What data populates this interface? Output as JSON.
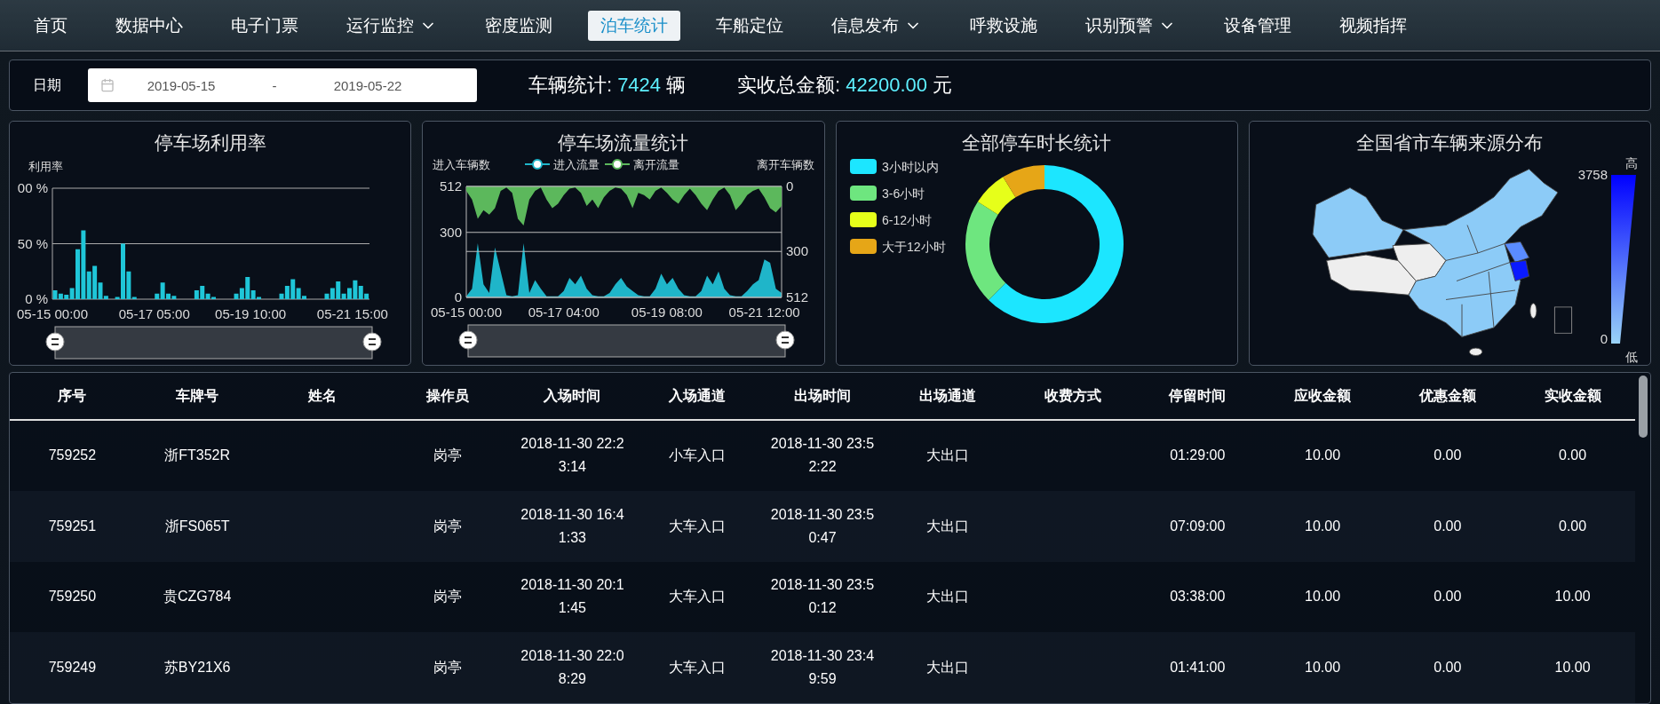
{
  "nav": {
    "items": [
      {
        "label": "首页",
        "selected": false,
        "has_menu": false
      },
      {
        "label": "数据中心",
        "selected": false,
        "has_menu": false
      },
      {
        "label": "电子门票",
        "selected": false,
        "has_menu": false
      },
      {
        "label": "运行监控",
        "selected": false,
        "has_menu": true
      },
      {
        "label": "密度监测",
        "selected": false,
        "has_menu": false
      },
      {
        "label": "泊车统计",
        "selected": true,
        "has_menu": false
      },
      {
        "label": "车船定位",
        "selected": false,
        "has_menu": false
      },
      {
        "label": "信息发布",
        "selected": false,
        "has_menu": true
      },
      {
        "label": "呼救设施",
        "selected": false,
        "has_menu": false
      },
      {
        "label": "识别预警",
        "selected": false,
        "has_menu": true
      },
      {
        "label": "设备管理",
        "selected": false,
        "has_menu": false
      },
      {
        "label": "视频指挥",
        "selected": false,
        "has_menu": false
      }
    ]
  },
  "filter": {
    "date_label": "日期",
    "start_date": "2019-05-15",
    "separator": "-",
    "end_date": "2019-05-22",
    "stats": [
      {
        "label": "车辆统计:",
        "value": "7424",
        "unit": "辆"
      },
      {
        "label": "实收总金额:",
        "value": "42200.00",
        "unit": "元"
      }
    ]
  },
  "panels": [
    {
      "title": "停车场利用率",
      "slider": true,
      "chart_data": {
        "type": "bar",
        "ylabel": "利用率",
        "ylim": [
          0,
          100
        ],
        "categories": [
          "05-15 00:00",
          null,
          null,
          null,
          null,
          null,
          null,
          null,
          null,
          null,
          null,
          null,
          null,
          null,
          null,
          null,
          null,
          null,
          "05-17 05:00",
          null,
          null,
          null,
          null,
          null,
          null,
          null,
          null,
          null,
          null,
          null,
          null,
          null,
          null,
          null,
          null,
          "05-19 10:00",
          null,
          null,
          null,
          null,
          null,
          null,
          null,
          null,
          null,
          null,
          null,
          null,
          null,
          null,
          null,
          null,
          null,
          "05-21 15:00",
          null,
          null
        ],
        "series": [
          {
            "color": "#1fc6d8",
            "values": [
              8,
              5,
              4,
              10,
              45,
              62,
              25,
              30,
              15,
              3,
              0,
              2,
              50,
              25,
              2,
              0,
              0,
              0,
              5,
              15,
              5,
              3,
              0,
              0,
              0,
              8,
              12,
              5,
              2,
              0,
              0,
              0,
              5,
              10,
              20,
              8,
              2,
              0,
              0,
              0,
              5,
              12,
              18,
              10,
              3,
              0,
              0,
              0,
              5,
              10,
              16,
              5,
              10,
              17,
              12,
              5
            ]
          }
        ],
        "yticks": [
          {
            "value": 0,
            "label": "0 %"
          },
          {
            "value": 50,
            "label": "50 %"
          }
        ]
      },
      "top_tick_label": "00 %"
    },
    {
      "title": "停车场流量统计",
      "slider": true,
      "layers": [
        {
          "chart_data": {
            "type": "area",
            "ylabel": "进入车辆数",
            "ylim": [
              0,
              512
            ],
            "categories": [
              "05-15 00:00",
              null,
              null,
              null,
              null,
              null,
              null,
              null,
              null,
              null,
              null,
              null,
              null,
              null,
              null,
              null,
              null,
              "05-17 04:00",
              null,
              null,
              null,
              null,
              null,
              null,
              null,
              null,
              null,
              null,
              null,
              null,
              null,
              null,
              null,
              null,
              null,
              "05-19 08:00",
              null,
              null,
              null,
              null,
              null,
              null,
              null,
              null,
              null,
              null,
              null,
              null,
              null,
              null,
              null,
              null,
              "05-21 12:00",
              null,
              null,
              null
            ],
            "series": [
              {
                "name": "进入流量",
                "color": "#1fb5c9",
                "values": [
                  5,
                  40,
                  250,
                  60,
                  20,
                  230,
                  120,
                  10,
                  5,
                  10,
                  250,
                  20,
                  80,
                  40,
                  5,
                  5,
                  5,
                  30,
                  90,
                  60,
                  100,
                  40,
                  10,
                  5,
                  5,
                  20,
                  60,
                  90,
                  50,
                  30,
                  10,
                  5,
                  5,
                  40,
                  110,
                  60,
                  90,
                  40,
                  10,
                  5,
                  5,
                  30,
                  100,
                  60,
                  120,
                  40,
                  10,
                  5,
                  5,
                  30,
                  60,
                  80,
                  175,
                  160,
                  40,
                  20
                ]
              }
            ],
            "yticks": [
              0,
              300,
              512
            ]
          }
        },
        {
          "chart_data": {
            "type": "area",
            "ylabel": "离开车辆数",
            "ylim": [
              512,
              0
            ],
            "series": [
              {
                "name": "离开流量",
                "color": "#5cb85c",
                "values": [
                  20,
                  60,
                  150,
                  110,
                  130,
                  100,
                  20,
                  5,
                  30,
                  150,
                  180,
                  60,
                  20,
                  5,
                  60,
                  100,
                  80,
                  40,
                  10,
                  5,
                  30,
                  90,
                  60,
                  100,
                  50,
                  20,
                  5,
                  10,
                  40,
                  100,
                  30,
                  40,
                  60,
                  20,
                  5,
                  30,
                  60,
                  80,
                  40,
                  10,
                  40,
                  80,
                  110,
                  60,
                  20,
                  5,
                  40,
                  110,
                  80,
                  40,
                  20,
                  10,
                  50,
                  100,
                  120,
                  90
                ]
              }
            ],
            "yticks": [
              0,
              300,
              512
            ]
          }
        }
      ]
    },
    {
      "title": "全部停车时长统计",
      "chart_data": {
        "type": "donut",
        "legend": "left",
        "categories": [
          "3小时以内",
          "3-6小时",
          "6-12小时",
          "大于12小时"
        ],
        "colors": [
          "#1ce6ff",
          "#6ee67f",
          "#e6ff1a",
          "#e6a617"
        ],
        "values": [
          0.625,
          0.215,
          0.072,
          0.088
        ]
      }
    },
    {
      "kind": "map",
      "title": "全国省市车辆来源分布",
      "visual_map": {
        "max": "3758",
        "min": "0",
        "high": "高",
        "low": "低"
      }
    }
  ],
  "table": {
    "columns": [
      "序号",
      "车牌号",
      "姓名",
      "操作员",
      "入场时间",
      "入场通道",
      "出场时间",
      "出场通道",
      "收费方式",
      "停留时间",
      "应收金额",
      "优惠金额",
      "实收金额"
    ],
    "rows": [
      [
        "759252",
        "浙FT352R",
        "",
        "岗亭",
        "2018-11-30 22:23:14",
        "小车入口",
        "2018-11-30 23:52:22",
        "大出口",
        "",
        "01:29:00",
        "10.00",
        "0.00",
        "0.00"
      ],
      [
        "759251",
        "浙FS065T",
        "",
        "岗亭",
        "2018-11-30 16:41:33",
        "大车入口",
        "2018-11-30 23:50:47",
        "大出口",
        "",
        "07:09:00",
        "10.00",
        "0.00",
        "0.00"
      ],
      [
        "759250",
        "贵CZG784",
        "",
        "岗亭",
        "2018-11-30 20:11:45",
        "大车入口",
        "2018-11-30 23:50:12",
        "大出口",
        "",
        "03:38:00",
        "10.00",
        "0.00",
        "10.00"
      ],
      [
        "759249",
        "苏BY21X6",
        "",
        "岗亭",
        "2018-11-30 22:08:29",
        "大车入口",
        "2018-11-30 23:49:59",
        "大出口",
        "",
        "01:41:00",
        "10.00",
        "0.00",
        "10.00"
      ]
    ]
  }
}
